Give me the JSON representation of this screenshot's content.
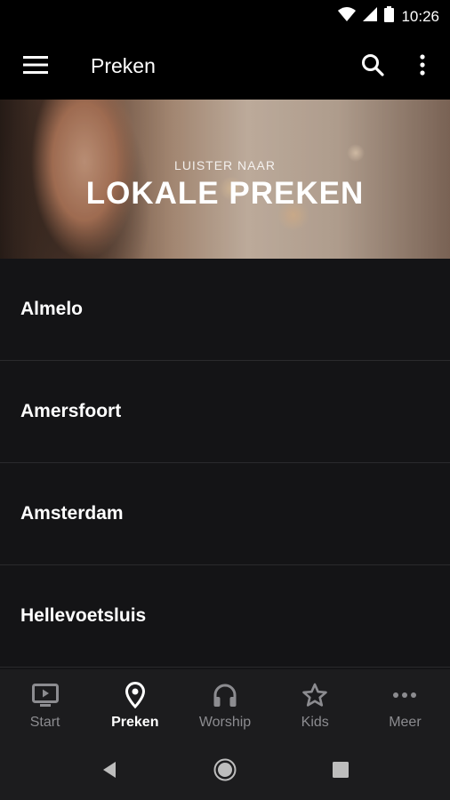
{
  "status_bar": {
    "time": "10:26",
    "icons": [
      "wifi-icon",
      "signal-icon",
      "battery-icon"
    ]
  },
  "app_bar": {
    "title": "Preken",
    "icons": [
      "menu-icon",
      "search-icon",
      "more-vert-icon"
    ]
  },
  "hero": {
    "kicker": "LUISTER NAAR",
    "heading": "LOKALE PREKEN"
  },
  "locations": [
    {
      "label": "Almelo"
    },
    {
      "label": "Amersfoort"
    },
    {
      "label": "Amsterdam"
    },
    {
      "label": "Hellevoetsluis"
    }
  ],
  "bottom_nav": {
    "active": "Preken",
    "items": [
      {
        "label": "Start",
        "icon": "tv-icon"
      },
      {
        "label": "Preken",
        "icon": "location-pin-icon"
      },
      {
        "label": "Worship",
        "icon": "headphones-icon"
      },
      {
        "label": "Kids",
        "icon": "star-icon"
      },
      {
        "label": "Meer",
        "icon": "more-horiz-icon"
      }
    ]
  },
  "system_nav": {
    "icons": [
      "back-icon",
      "home-icon",
      "recents-icon"
    ]
  },
  "colors": {
    "background": "#141416",
    "app_bar": "#000000",
    "nav_bar": "#1c1c1e",
    "inactive": "#8c8c90",
    "active": "#ffffff"
  }
}
